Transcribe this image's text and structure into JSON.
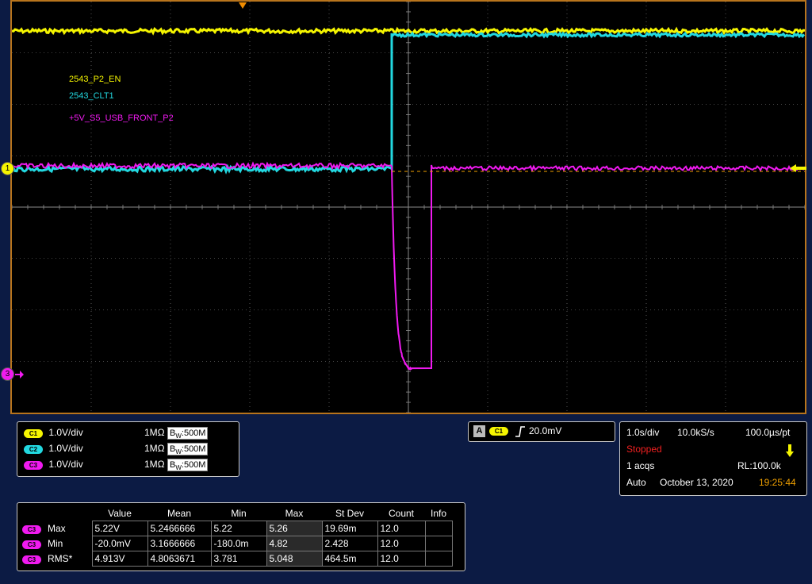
{
  "waveform_labels": {
    "ch1": "2543_P2_EN",
    "ch2": "2543_CLT1",
    "ch3": "+5V_S5_USB_FRONT_P2"
  },
  "markers": {
    "ch1_handle": "1",
    "ch3_handle": "3"
  },
  "colors": {
    "ch1": "#f5f500",
    "ch2": "#22d8e0",
    "ch3": "#f01af0",
    "trigger_level": "#f0a000",
    "graticule": "#8a8a8a",
    "frame": "#b8741c",
    "background": "#0c1b44"
  },
  "channels": [
    {
      "chip": "C1",
      "scale": "1.0V/div",
      "impedance": "1MΩ",
      "bw_prefix": "B",
      "bw_sub": "W",
      "bw_value": ":500M",
      "color": "#f5f500"
    },
    {
      "chip": "C2",
      "scale": "1.0V/div",
      "impedance": "1MΩ",
      "bw_prefix": "B",
      "bw_sub": "W",
      "bw_value": ":500M",
      "color": "#22d8e0"
    },
    {
      "chip": "C3",
      "scale": "1.0V/div",
      "impedance": "1MΩ",
      "bw_prefix": "B",
      "bw_sub": "W",
      "bw_value": ":500M",
      "color": "#f01af0"
    }
  ],
  "trigger": {
    "mode_letter": "A",
    "source": "C1",
    "slope_icon": "rising-edge-icon",
    "level": "20.0mV"
  },
  "acquisition": {
    "timebase": "1.0s/div",
    "sample_rate": "10.0kS/s",
    "resolution": "100.0µs/pt",
    "state": "Stopped",
    "acqs": "1 acqs",
    "record_length": "RL:100.0k",
    "trigger_mode": "Auto",
    "date": "October 13, 2020",
    "time": "19:25:44"
  },
  "measurements": {
    "headers": [
      "Value",
      "Mean",
      "Min",
      "Max",
      "St Dev",
      "Count",
      "Info"
    ],
    "rows": [
      {
        "chip": "C3",
        "label": "Max",
        "values": [
          "5.22V",
          "5.2466666",
          "5.22",
          "5.26",
          "19.69m",
          "12.0",
          ""
        ]
      },
      {
        "chip": "C3",
        "label": "Min",
        "values": [
          "-20.0mV",
          "3.1666666",
          "-180.0m",
          "4.82",
          "2.428",
          "12.0",
          ""
        ]
      },
      {
        "chip": "C3",
        "label": "RMS*",
        "values": [
          "4.913V",
          "4.8063671",
          "3.781",
          "5.048",
          "464.5m",
          "12.0",
          ""
        ]
      }
    ]
  }
}
